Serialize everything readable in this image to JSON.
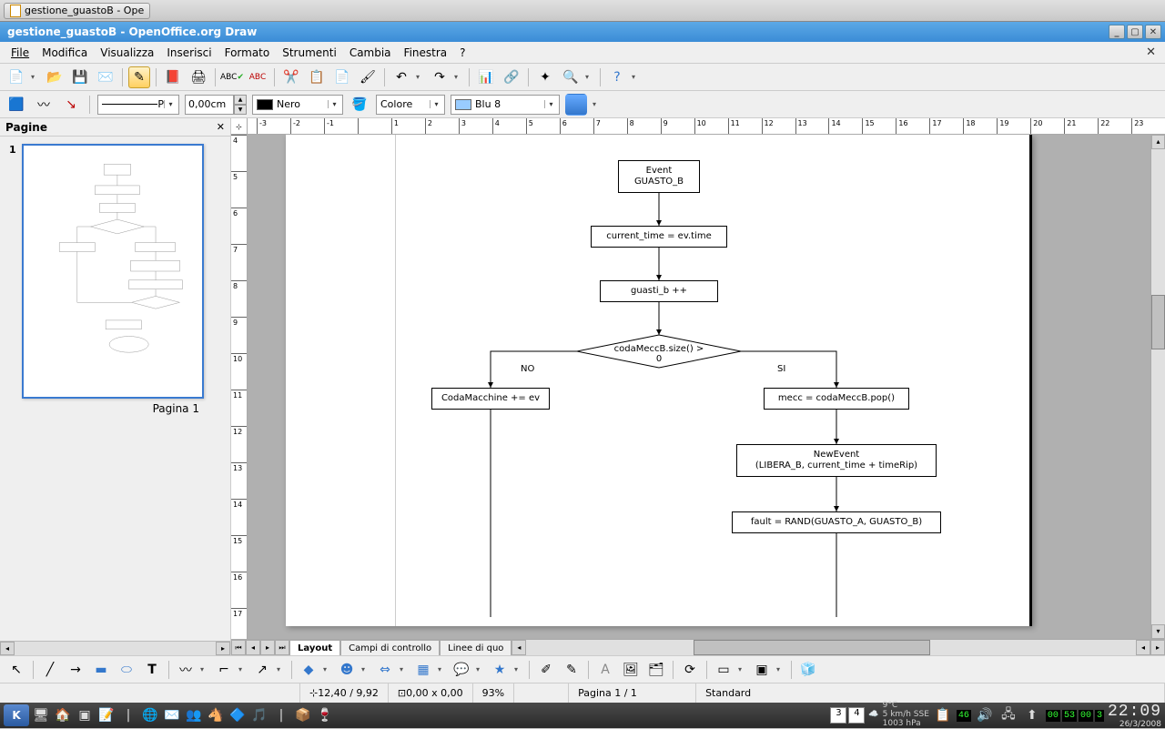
{
  "desktop_tab": "gestione_guastoB - Ope",
  "window_title": "gestione_guastoB - OpenOffice.org Draw",
  "menus": [
    "File",
    "Modifica",
    "Visualizza",
    "Inserisci",
    "Formato",
    "Strumenti",
    "Cambia",
    "Finestra",
    "?"
  ],
  "line_width": "0,00cm",
  "line_color_label": "Nero",
  "fill_mode_label": "Colore",
  "fill_color_label": "Blu 8",
  "style_name": "P",
  "pages_panel_title": "Pagine",
  "page_number": "1",
  "page_caption": "Pagina 1",
  "ruler_h": [
    "-3",
    "-2",
    "-1",
    "",
    "1",
    "2",
    "3",
    "4",
    "5",
    "6",
    "7",
    "8",
    "9",
    "10",
    "11",
    "12",
    "13",
    "14",
    "15",
    "16",
    "17",
    "18",
    "19",
    "20",
    "21",
    "22",
    "23"
  ],
  "ruler_v": [
    "4",
    "5",
    "6",
    "7",
    "8",
    "9",
    "10",
    "11",
    "12",
    "13",
    "14",
    "15",
    "16",
    "17"
  ],
  "flowchart": {
    "n1": "Event\nGUASTO_B",
    "n2": "current_time = ev.time",
    "n3": "guasti_b ++",
    "d1": "codaMeccB.size() > 0",
    "no": "NO",
    "si": "SI",
    "n4": "CodaMacchine += ev",
    "n5": "mecc = codaMeccB.pop()",
    "n6": "NewEvent\n(LIBERA_B, current_time + timeRip)",
    "n7": "fault = RAND(GUASTO_A, GUASTO_B)"
  },
  "tabs": [
    "Layout",
    "Campi di controllo",
    "Linee di quo"
  ],
  "status": {
    "coords": "12,40 / 9,92",
    "size": "0,00 x 0,00",
    "zoom": "93%",
    "page": "Pagina 1 / 1",
    "mode": "Standard"
  },
  "tray": {
    "desk_a": "3",
    "desk_b": "4",
    "temp": "9°C",
    "wind": "5 km/h SSE",
    "pressure": "1003 hPa",
    "ind": "46",
    "seg1": "00",
    "seg2": "53",
    "seg3": "00",
    "seg4": "3",
    "clock": "22:09",
    "date": "26/3/2008"
  }
}
